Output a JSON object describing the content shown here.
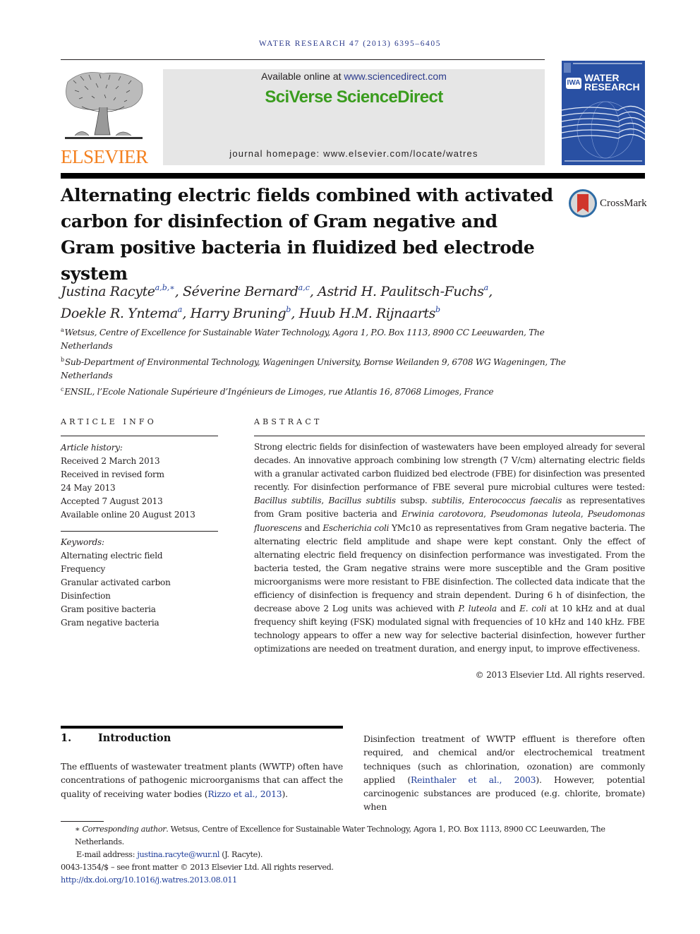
{
  "running_header": "WATER RESEARCH 47 (2013) 6395–6405",
  "publisher": {
    "logo_wordmark": "ELSEVIER",
    "logo_icon": "elsevier-tree-icon",
    "brand_color": "#f48120"
  },
  "sciencedirect": {
    "available_prefix": "Available online at ",
    "available_link": "www.sciencedirect.com",
    "brand": "SciVerse ScienceDirect",
    "brand_color": "#3a9c1e",
    "homepage": "journal homepage: www.elsevier.com/locate/watres"
  },
  "journal_cover": {
    "badge": "IWA",
    "title_line1": "WATER",
    "title_line2": "RESEARCH",
    "cover_color": "#2950a3"
  },
  "crossmark": {
    "label": "CrossMark",
    "icon": "crossmark-icon"
  },
  "article": {
    "title": "Alternating electric fields combined with activated carbon for disinfection of Gram negative and Gram positive bacteria in fluidized bed electrode system",
    "authors": [
      {
        "name": "Justina Racyte",
        "sup": "a,b,∗",
        "sep": ", "
      },
      {
        "name": "Séverine Bernard",
        "sup": "a,c",
        "sep": ", "
      },
      {
        "name": "Astrid H. Paulitsch-Fuchs",
        "sup": "a",
        "sep": ","
      },
      {
        "name": "Doekle R. Yntema",
        "sup": "a",
        "sep": ", "
      },
      {
        "name": "Harry Bruning",
        "sup": "b",
        "sep": ", "
      },
      {
        "name": "Huub H.M. Rijnaarts",
        "sup": "b",
        "sep": ""
      }
    ],
    "affiliations": [
      {
        "key": "a",
        "text": "Wetsus, Centre of Excellence for Sustainable Water Technology, Agora 1, P.O. Box 1113, 8900 CC Leeuwarden, The Netherlands"
      },
      {
        "key": "b",
        "text": "Sub-Department of Environmental Technology, Wageningen University, Bornse Weilanden 9, 6708 WG Wageningen, The Netherlands"
      },
      {
        "key": "c",
        "text": "ENSIL, l’Ecole Nationale Supérieure d’Ingénieurs de Limoges, rue Atlantis 16, 87068 Limoges, France"
      }
    ]
  },
  "article_info": {
    "label": "ARTICLE INFO",
    "history_heading": "Article history:",
    "history": [
      "Received 2 March 2013",
      "Received in revised form",
      "24 May 2013",
      "Accepted 7 August 2013",
      "Available online 20 August 2013"
    ],
    "keywords_heading": "Keywords:",
    "keywords": [
      "Alternating electric field",
      "Frequency",
      "Granular activated carbon",
      "Disinfection",
      "Gram positive bacteria",
      "Gram negative bacteria"
    ]
  },
  "abstract": {
    "label": "ABSTRACT",
    "segments": [
      {
        "t": "Strong electric fields for disinfection of wastewaters have been employed already for several decades. An innovative approach combining low strength (7 V/cm) alternating electric fields with a granular activated carbon fluidized bed electrode (FBE) for disinfection was presented recently. For disinfection performance of FBE several pure microbial cultures were tested: "
      },
      {
        "t": "Bacillus subtilis",
        "i": true
      },
      {
        "t": ", "
      },
      {
        "t": "Bacillus subtilis",
        "i": true
      },
      {
        "t": " subsp. "
      },
      {
        "t": "subtilis",
        "i": true
      },
      {
        "t": ", "
      },
      {
        "t": "Enterococcus faecalis",
        "i": true
      },
      {
        "t": " as representatives from Gram positive bacteria and "
      },
      {
        "t": "Erwinia carotovora",
        "i": true
      },
      {
        "t": ", "
      },
      {
        "t": "Pseudomonas luteola",
        "i": true
      },
      {
        "t": ", "
      },
      {
        "t": "Pseudomonas fluorescens",
        "i": true
      },
      {
        "t": " and "
      },
      {
        "t": "Escherichia coli",
        "i": true
      },
      {
        "t": " YMc10 as representatives from Gram negative bacteria. The alternating electric field amplitude and shape were kept constant. Only the effect of alternating electric field frequency on disinfection performance was investigated. From the bacteria tested, the Gram negative strains were more susceptible and the Gram positive microorganisms were more resistant to FBE disinfection. The collected data indicate that the efficiency of disinfection is frequency and strain dependent. During 6 h of disinfection, the decrease above 2 Log units was achieved with "
      },
      {
        "t": "P. luteola",
        "i": true
      },
      {
        "t": " and "
      },
      {
        "t": "E. coli",
        "i": true
      },
      {
        "t": " at 10 kHz and at dual frequency shift keying (FSK) modulated signal with frequencies of 10 kHz and 140 kHz. FBE technology appears to offer a new way for selective bacterial disinfection, however further optimizations are needed on treatment duration, and energy input, to improve effectiveness."
      }
    ],
    "copyright": "© 2013 Elsevier Ltd. All rights reserved."
  },
  "introduction": {
    "number": "1.",
    "heading": "Introduction",
    "col1": [
      {
        "t": "The effluents of wastewater treatment plants (WWTP) often have concentrations of pathogenic microorganisms that can affect the quality of receiving water bodies ("
      },
      {
        "t": "Rizzo et al., 2013",
        "link": true
      },
      {
        "t": ")."
      }
    ],
    "col2": [
      {
        "t": "Disinfection treatment of WWTP effluent is therefore often required, and chemical and/or electrochemical treatment techniques (such as chlorination, ozonation) are commonly applied ("
      },
      {
        "t": "Reinthaler et al., 2003",
        "link": true
      },
      {
        "t": "). However, potential carcinogenic substances are produced (e.g. chlorite, bromate) when"
      }
    ]
  },
  "footnotes": {
    "corresponding_mark": "∗",
    "corresponding_label": "Corresponding author",
    "corresponding_text": ". Wetsus, Centre of Excellence for Sustainable Water Technology, Agora 1, P.O. Box 1113, 8900 CC Leeuwarden, The Netherlands.",
    "email_label": "E-mail address: ",
    "email": "justina.racyte@wur.nl",
    "email_suffix": " (J. Racyte).",
    "issn_line": "0043-1354/$ – see front matter © 2013 Elsevier Ltd. All rights reserved.",
    "doi": "http://dx.doi.org/10.1016/j.watres.2013.08.011"
  }
}
